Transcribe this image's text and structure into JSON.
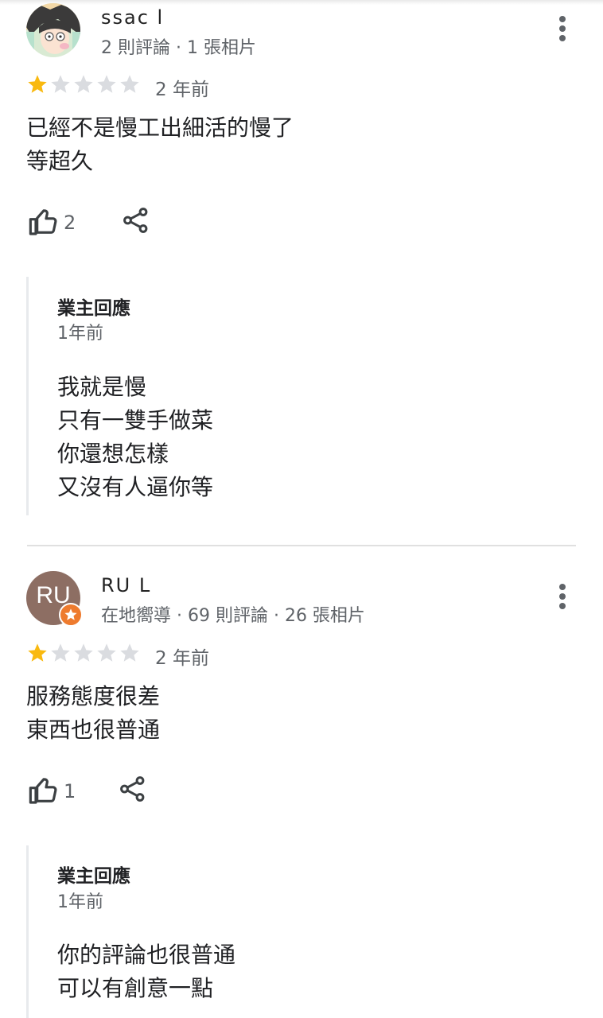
{
  "reviews": [
    {
      "reviewer_name": "ssac l",
      "reviewer_meta": "2 則評論 · 1 張相片",
      "rating": 1,
      "max_rating": 5,
      "time": "2 年前",
      "text": "已經不是慢工出細活的慢了\n等超久",
      "like_count": "2",
      "owner_reply": {
        "title": "業主回應",
        "time": "1年前",
        "text": "我就是慢\n只有一雙手做菜\n你還想怎樣\n又沒有人逼你等"
      }
    },
    {
      "reviewer_name": "RU L",
      "avatar_initials": "RU",
      "reviewer_meta": "在地嚮導 · 69 則評論 · 26 張相片",
      "rating": 1,
      "max_rating": 5,
      "time": "2 年前",
      "text": "服務態度很差\n東西也很普通",
      "like_count": "1",
      "owner_reply": {
        "title": "業主回應",
        "time": "1年前",
        "text": "你的評論也很普通\n可以有創意一點"
      }
    }
  ],
  "icons": {
    "more": "more-vert-icon",
    "like": "thumb-up-icon",
    "share": "share-icon",
    "star": "star-icon",
    "local_guide": "local-guide-badge-icon"
  },
  "colors": {
    "star_filled": "#f9b90f",
    "star_empty": "#dadce0",
    "avatar_ru": "#8d6e63",
    "local_guide_badge": "#ee7b2e"
  }
}
